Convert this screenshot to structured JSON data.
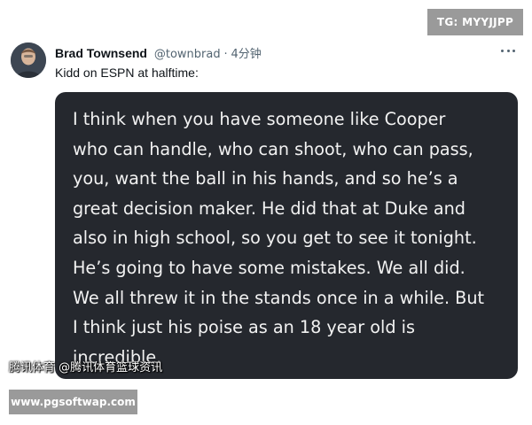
{
  "overlay": {
    "tg_badge": "TG: MYYJJPP",
    "watermark": "腾讯体育 @腾讯体育篮球资讯",
    "site_url": "www.pgsoftwap.com"
  },
  "tweet": {
    "author_name": "Brad Townsend",
    "handle": "@townbrad",
    "separator": "·",
    "time": "4分钟",
    "text": "Kidd on ESPN at halftime:",
    "media_quote": "I think when you have someone like Cooper\nwho can handle, who can shoot, who can pass,\nyou, want the ball in his hands, and so he’s a\ngreat decision maker. He did that at Duke and\nalso in high school, so you get to see it tonight.\nHe’s going to have some mistakes. We all did.\nWe all threw it in the stands once in a while. But\nI think just his poise as an 18 year old is\nincredible."
  },
  "icons": {
    "more": "more-horizontal-icon",
    "avatar": "user-avatar"
  }
}
